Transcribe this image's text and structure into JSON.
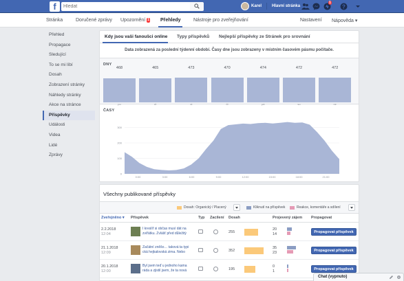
{
  "topbar": {
    "logo": "f",
    "search_placeholder": "Hledat",
    "user_name": "Karel",
    "home_label": "Hlavní stránka",
    "icons": [
      "friends-icon",
      "messages-icon",
      "notifications-icon",
      "help-icon",
      "account-menu-icon"
    ],
    "notification_count": "1",
    "brand_color": "#4267b2"
  },
  "pagenav": {
    "items": [
      {
        "label": "Stránka"
      },
      {
        "label": "Doručené zprávy"
      },
      {
        "label": "Upozornění",
        "badge": "1"
      },
      {
        "label": "Přehledy",
        "active": true
      },
      {
        "label": "Nástroje pro zveřejňování"
      }
    ],
    "settings": "Nastavení",
    "help": "Nápověda ▾"
  },
  "sidebar": {
    "items": [
      {
        "label": "Přehled"
      },
      {
        "label": "Propagace"
      },
      {
        "label": "Sledující"
      },
      {
        "label": "To se mi líbí"
      },
      {
        "label": "Dosah"
      },
      {
        "label": "Zobrazení stránky"
      },
      {
        "label": "Náhledy stránky"
      },
      {
        "label": "Akce na stránce"
      },
      {
        "label": "Příspěvky",
        "active": true
      },
      {
        "label": "Události"
      },
      {
        "label": "Videa"
      },
      {
        "label": "Lidé"
      },
      {
        "label": "Zprávy"
      }
    ]
  },
  "fans_panel": {
    "tabs": [
      "Kdy jsou vaši fanoušci online",
      "Typy příspěvků",
      "Nejlepší příspěvky ze Stránek pro srovnání"
    ],
    "notice": "Data zobrazená za poslední týdenní období. Časy dne jsou zobrazeny v místním časovém pásmu počítače.",
    "days_label": "DNY",
    "times_label": "ČASY"
  },
  "chart_data": [
    {
      "type": "bar",
      "title": "DNY",
      "categories": [
        "po",
        "út",
        "st",
        "čt",
        "pá",
        "so",
        "ne"
      ],
      "values": [
        468,
        465,
        473,
        470,
        474,
        472,
        472
      ]
    },
    {
      "type": "area",
      "title": "ČASY",
      "x": [
        "0:00",
        "3:00",
        "6:00",
        "9:00",
        "12:00",
        "15:00",
        "18:00",
        "21:00"
      ],
      "ylim": [
        0,
        400
      ],
      "yticks": [
        0,
        100,
        200,
        300
      ],
      "series": [
        {
          "values": [
            140,
            110,
            70,
            45,
            30,
            25,
            22,
            25,
            35,
            60,
            100,
            160,
            215,
            290,
            315,
            320,
            325,
            322,
            328,
            330,
            326,
            330,
            335,
            330,
            332,
            318,
            270,
            215,
            150,
            95
          ]
        }
      ],
      "fill_color": "#a9b6d6"
    }
  ],
  "posts_panel": {
    "title": "Všechny publikované příspěvky",
    "legend": {
      "reach": "Dosah: Organický / Placený",
      "clicks": "Kliknutí na příspěvek",
      "reactions": "Reakce, komentáře a sdílení"
    },
    "headers": {
      "published": "Zveřejněno ▾",
      "post": "Příspěvek",
      "type": "Typ",
      "targeting": "Zacílení",
      "reach": "Dosah",
      "engagement": "Projevený zájem",
      "promote": "Propagovat"
    },
    "rows": [
      {
        "date": "2.2.2018",
        "time": "12:04",
        "text": "I kreslíř si občas musí dát na zvířátku. Zvlášť před důležitý",
        "reach": "255",
        "reach_fraction": 0.5,
        "clicks": "20",
        "reactions": "14",
        "promote_label": "Propagovat příspěvek"
      },
      {
        "date": "21.1.2018",
        "time": "12:09",
        "text": "Začátní zněšo… taková ta typi cká hejkalovská zima. Nebo",
        "reach": "352",
        "reach_fraction": 0.7,
        "clicks": "35",
        "reactions": "23",
        "promote_label": "Propagovat příspěvek"
      },
      {
        "date": "20.1.2018",
        "time": "12:00",
        "text": "Byl jsem teď u jednoho kama ráda a zjistil jsem, že ta nová",
        "reach": "195",
        "reach_fraction": 0.4,
        "clicks": "0",
        "reactions": "1",
        "promote_label": "Propagovat příspěvek"
      }
    ]
  },
  "chat": {
    "label": "Chat (vypnuto)"
  }
}
